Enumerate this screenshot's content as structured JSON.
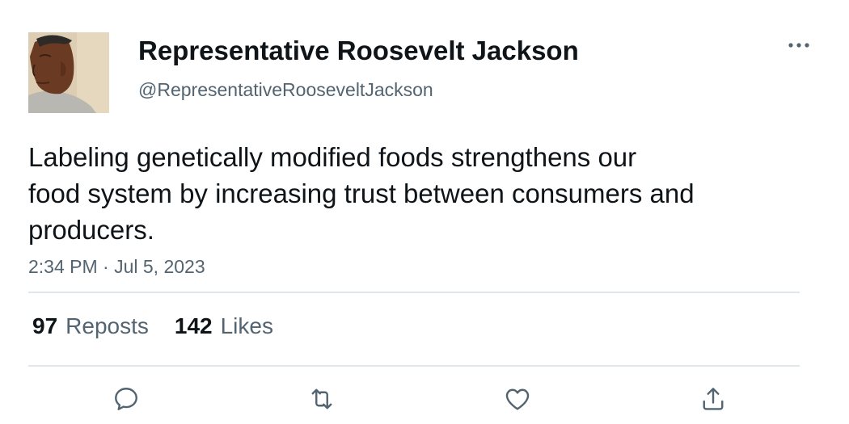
{
  "author": {
    "display_name": "Representative Roosevelt Jackson",
    "handle": "@RepresentativeRooseveltJackson"
  },
  "tweet": {
    "text_lines": [
      "Labeling genetically modified foods strengthens our",
      "food system by increasing trust between consumers and",
      "producers."
    ],
    "timestamp": "2:34 PM · Jul 5, 2023"
  },
  "stats": {
    "reposts_count": "97",
    "reposts_label": "Reposts",
    "likes_count": "142",
    "likes_label": "Likes"
  },
  "icons": {
    "more": "more-horizontal-icon",
    "reply": "reply-icon",
    "repost": "repost-icon",
    "like": "heart-icon",
    "share": "share-icon"
  },
  "colors": {
    "text_primary": "#0f1419",
    "text_secondary": "#536471",
    "divider": "#e1e6ea",
    "icon": "#536471"
  }
}
